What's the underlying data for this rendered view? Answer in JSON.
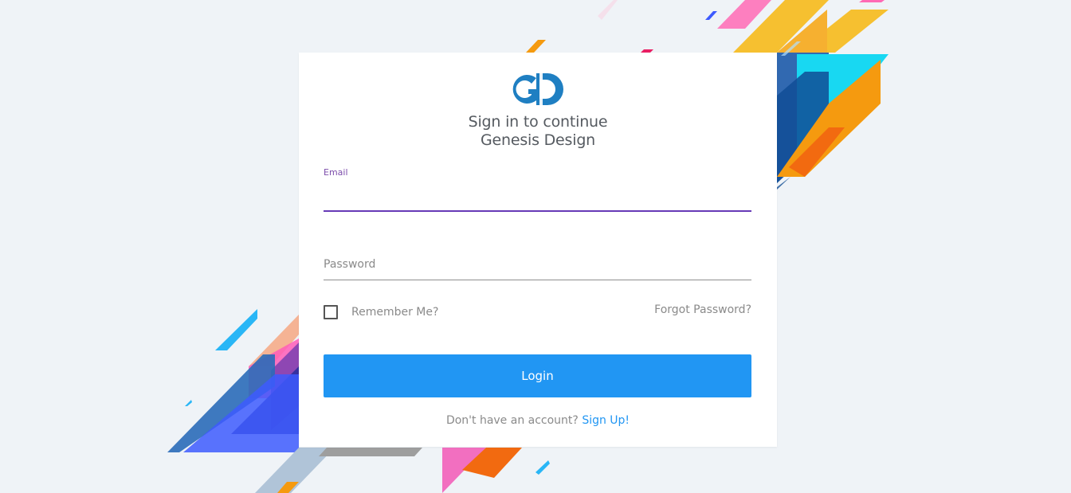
{
  "brand": {
    "logo_text": "GD",
    "logo_color": "#1f7fc2"
  },
  "title": {
    "line1": "Sign in to continue",
    "line2": "Genesis Design"
  },
  "form": {
    "email_label": "Email",
    "email_value": "",
    "password_placeholder": "Password",
    "password_value": "",
    "remember_label": "Remember Me?",
    "remember_checked": false,
    "forgot_label": "Forgot Password?",
    "login_label": "Login"
  },
  "footer": {
    "prompt": "Don't have an account?",
    "signup_label": "Sign Up!"
  },
  "colors": {
    "accent": "#2196f3",
    "focus_underline": "#673ab7",
    "background": "#eff3f7"
  }
}
